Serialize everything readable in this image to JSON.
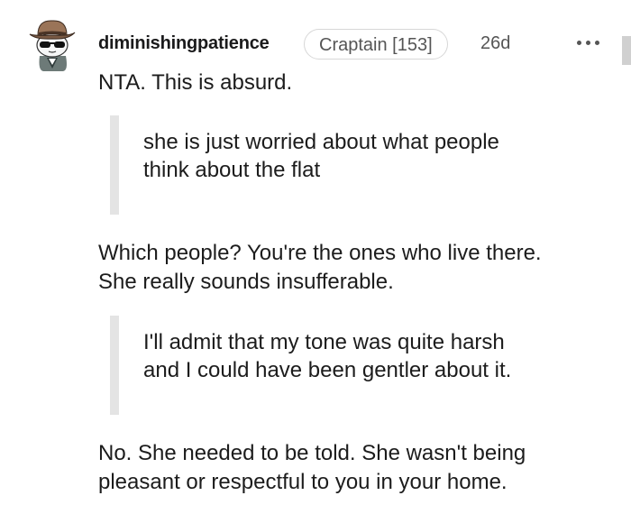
{
  "comment": {
    "author": "diminishingpatience",
    "flair": "Craptain [153]",
    "age": "26d",
    "more_icon": "more-horizontal-icon",
    "avatar_icon": "snoo-cowboy-avatar-icon",
    "paragraphs": {
      "p1": "NTA. This is absurd.",
      "q1_line1": "she is just worried about what people",
      "q1_line2": "think about the flat",
      "p2_line1": "Which people? You're the ones who live there.",
      "p2_line2": "She really sounds insufferable.",
      "q2_line1": "I'll admit that my tone was quite harsh",
      "q2_line2": "and I could have been gentler about it.",
      "p3_line1": "No. She needed to be told. She wasn't being",
      "p3_line2": "pleasant or respectful to you in your home."
    }
  },
  "colors": {
    "text": "#1c1c1c",
    "meta": "#555555",
    "quote_bar": "#e4e4e4",
    "flair_border": "#d7d7d7"
  }
}
